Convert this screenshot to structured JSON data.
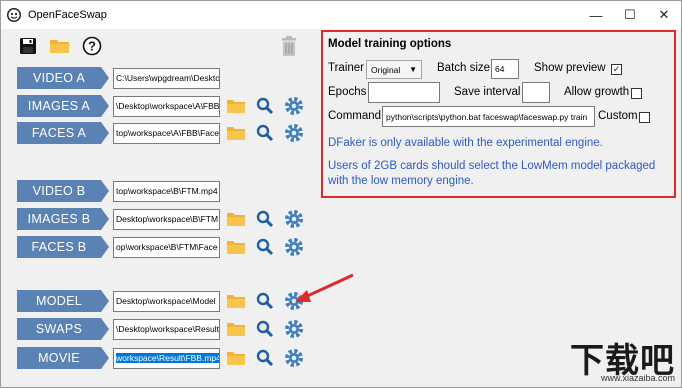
{
  "window": {
    "title": "OpenFaceSwap",
    "controls": {
      "minimize": "—",
      "maximize": "☐",
      "close": "✕"
    }
  },
  "toolbar": {
    "icons": [
      "save-icon",
      "folder-open-icon",
      "help-icon"
    ],
    "help_label": "?",
    "trash_icon": "trash-icon"
  },
  "rows": [
    {
      "label": "VIDEO A",
      "path": "C:\\Users\\wpgdream\\Deskto",
      "has_actions": false
    },
    {
      "label": "IMAGES A",
      "path": "\\Desktop\\workspace\\A\\FBB",
      "has_actions": true
    },
    {
      "label": "FACES A",
      "path": "top\\workspace\\A\\FBB\\Face",
      "has_actions": true
    },
    {
      "label": "VIDEO B",
      "path": "top\\workspace\\B\\FTM.mp4",
      "has_actions": false
    },
    {
      "label": "IMAGES B",
      "path": "Desktop\\workspace\\B\\FTM",
      "has_actions": true
    },
    {
      "label": "FACES B",
      "path": "op\\workspace\\B\\FTM\\Face",
      "has_actions": true
    },
    {
      "label": "MODEL",
      "path": "Desktop\\workspace\\Model",
      "has_actions": true
    },
    {
      "label": "SWAPS",
      "path": "\\Desktop\\workspace\\Result",
      "has_actions": true
    },
    {
      "label": "MOVIE",
      "path": "workspace\\Result\\FBB.mp4",
      "has_actions": true,
      "selected": true
    }
  ],
  "options": {
    "title": "Model training options",
    "trainer_label": "Trainer",
    "trainer_value": "Original",
    "batch_size_label": "Batch size",
    "batch_size_value": "64",
    "show_preview_label": "Show preview",
    "show_preview_checked": true,
    "epochs_label": "Epochs",
    "epochs_value": "",
    "save_interval_label": "Save interval",
    "save_interval_value": "",
    "allow_growth_label": "Allow growth",
    "allow_growth_checked": false,
    "command_label": "Command",
    "command_value": "python\\scripts\\python.bat faceswap\\faceswap.py train",
    "custom_label": "Custom",
    "custom_checked": false,
    "info1": "DFaker is only available with the experimental engine.",
    "info2": "Users of 2GB cards should select the LowMem model packaged with the low memory engine.",
    "check_mark": "✓"
  },
  "watermark": {
    "big": "下载吧",
    "small": "www.xiazaiba.com"
  },
  "colors": {
    "accent": "#5a82b4",
    "highlight_border": "#e02a2a",
    "info_text": "#2e59c7",
    "folder": "#f2b233",
    "gear": "#3f7fbf",
    "search": "#1f5fa0"
  }
}
